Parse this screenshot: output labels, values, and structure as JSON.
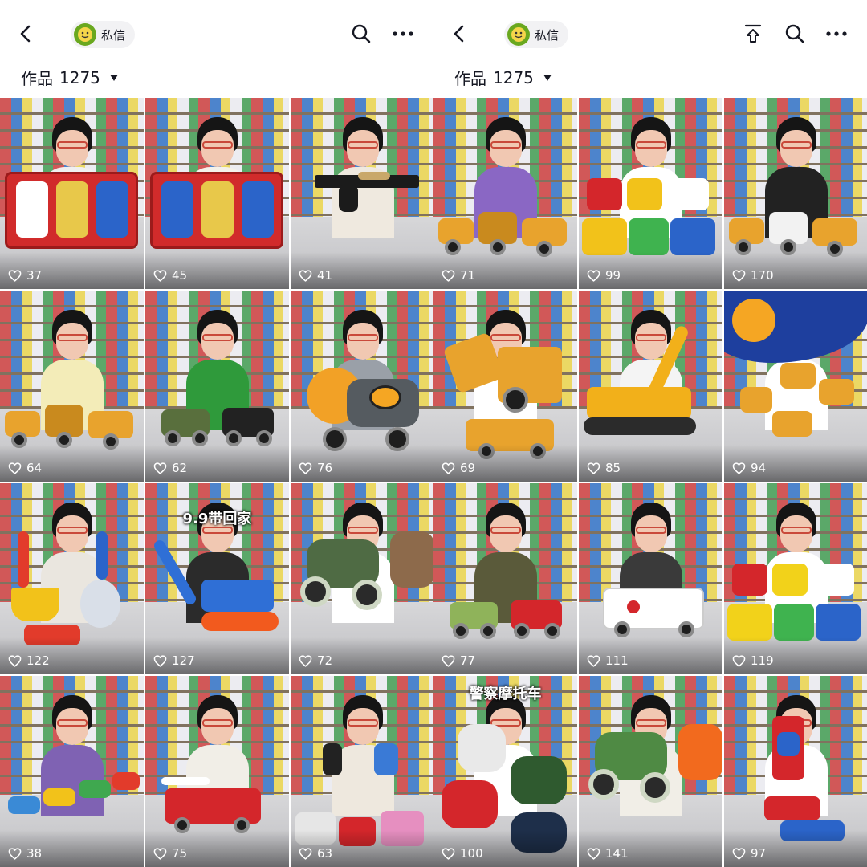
{
  "screens": [
    {
      "chip_label": "私信",
      "works_label": "作品",
      "works_count": "1275",
      "show_pin": false,
      "tiles": [
        {
          "likes": "37",
          "theme": "robots-box",
          "shirt": "#f0f0f0",
          "toy": "#d12b2b",
          "toy2": "#ffffff",
          "overlay": ""
        },
        {
          "likes": "45",
          "theme": "robots-box",
          "shirt": "#f4f1ea",
          "toy": "#d12b2b",
          "toy2": "#2b64c9",
          "overlay": ""
        },
        {
          "likes": "41",
          "theme": "gun",
          "shirt": "#efe9df",
          "toy": "#1b1b1b",
          "toy2": "#c9a86a",
          "overlay": ""
        },
        {
          "likes": "64",
          "theme": "excavator-row",
          "shirt": "#f3ecb8",
          "toy": "#e8a32d",
          "toy2": "#c98a1e",
          "overlay": ""
        },
        {
          "likes": "62",
          "theme": "jeeps",
          "shirt": "#2f9a3b",
          "toy": "#596f3d",
          "toy2": "#222222",
          "overlay": ""
        },
        {
          "likes": "76",
          "theme": "mixer",
          "shirt": "#9aa0a8",
          "toy": "#f2a126",
          "toy2": "#555b60",
          "overlay": ""
        },
        {
          "likes": "122",
          "theme": "sand",
          "shirt": "#eae6df",
          "toy": "#f2c21a",
          "toy2": "#e23b2b",
          "overlay": ""
        },
        {
          "likes": "127",
          "theme": "crane",
          "shirt": "#2b2b2b",
          "toy": "#2f6fd6",
          "toy2": "#f25a1e",
          "overlay": "9.9带回家"
        },
        {
          "likes": "72",
          "theme": "monster",
          "shirt": "#ffffff",
          "toy": "#4f6b44",
          "toy2": "#8d6a4b",
          "overlay": ""
        },
        {
          "likes": "38",
          "theme": "train",
          "shirt": "#7f62b3",
          "toy": "#3a8ad6",
          "toy2": "#f2c21a",
          "overlay": ""
        },
        {
          "likes": "75",
          "theme": "firetruck",
          "shirt": "#f1eee7",
          "toy": "#d4262b",
          "toy2": "#ffffff",
          "overlay": ""
        },
        {
          "likes": "63",
          "theme": "mini-cars",
          "shirt": "#eee8de",
          "toy": "#d4262b",
          "toy2": "#e68fc0",
          "overlay": ""
        }
      ]
    },
    {
      "chip_label": "私信",
      "works_label": "作品",
      "works_count": "1275",
      "show_pin": true,
      "tiles": [
        {
          "likes": "71",
          "theme": "excavator-row",
          "shirt": "#8a67c4",
          "toy": "#e8a32d",
          "toy2": "#c98a1e",
          "overlay": ""
        },
        {
          "likes": "99",
          "theme": "cartoon-trucks",
          "shirt": "#ffffff",
          "toy": "#f2c21a",
          "toy2": "#2b64c9",
          "overlay": ""
        },
        {
          "likes": "170",
          "theme": "excavator-row",
          "shirt": "#222222",
          "toy": "#e8a32d",
          "toy2": "#f2f2f2",
          "overlay": ""
        },
        {
          "likes": "69",
          "theme": "loader",
          "shirt": "#ffffff",
          "toy": "#e8a32d",
          "toy2": "#2b2b2b",
          "overlay": ""
        },
        {
          "likes": "85",
          "theme": "excavator-big",
          "shirt": "#f4f4f4",
          "toy": "#f2b01a",
          "toy2": "#2b2b2b",
          "overlay": ""
        },
        {
          "likes": "94",
          "theme": "playmat",
          "shirt": "#ffffff",
          "toy": "#e8a32d",
          "toy2": "#2a6fd0",
          "overlay": ""
        },
        {
          "likes": "77",
          "theme": "jeeps",
          "shirt": "#5a5a3a",
          "toy": "#8fb35a",
          "toy2": "#d4262b",
          "overlay": ""
        },
        {
          "likes": "111",
          "theme": "ambulance",
          "shirt": "#3a3a3a",
          "toy": "#ffffff",
          "toy2": "#d4262b",
          "overlay": ""
        },
        {
          "likes": "119",
          "theme": "cartoon-trucks",
          "shirt": "#ffffff",
          "toy": "#f2d21a",
          "toy2": "#2b64c9",
          "overlay": ""
        },
        {
          "likes": "100",
          "theme": "motorbike",
          "shirt": "#ffffff",
          "toy": "#d4262b",
          "toy2": "#2f5a2f",
          "overlay": "警察摩托车"
        },
        {
          "likes": "141",
          "theme": "monster",
          "shirt": "#f1eee7",
          "toy": "#4f8a44",
          "toy2": "#f26a1e",
          "overlay": ""
        },
        {
          "likes": "97",
          "theme": "robots",
          "shirt": "#ffffff",
          "toy": "#d4262b",
          "toy2": "#2b64c9",
          "overlay": ""
        }
      ]
    }
  ]
}
